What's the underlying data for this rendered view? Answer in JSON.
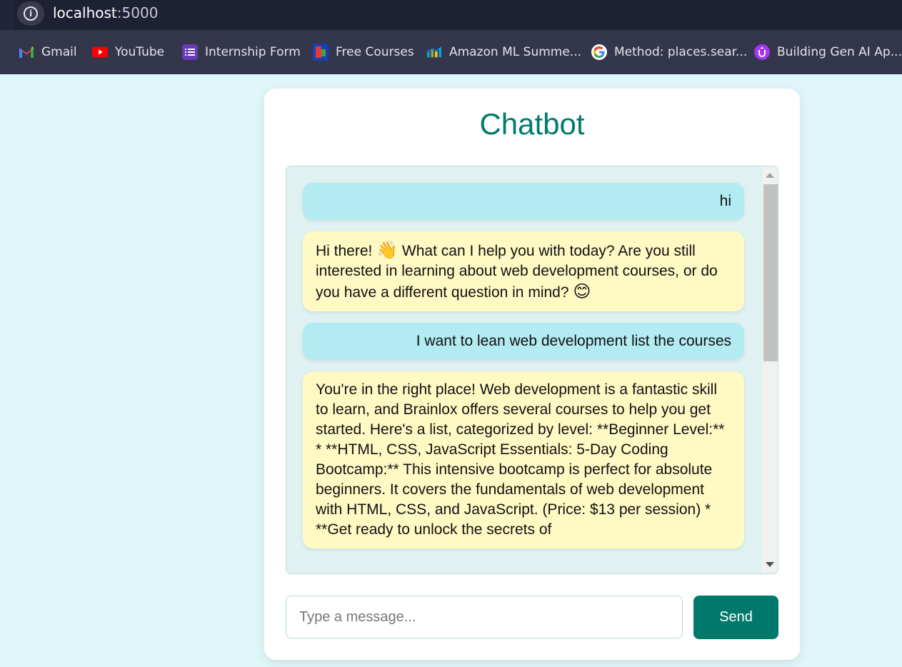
{
  "browser": {
    "url_host": "localhost",
    "url_port": ":5000",
    "bookmarks": [
      {
        "label": "Gmail",
        "icon": "gmail-icon"
      },
      {
        "label": "YouTube",
        "icon": "youtube-icon"
      },
      {
        "label": "Internship Form",
        "icon": "forms-icon"
      },
      {
        "label": "Free Courses",
        "icon": "courses-icon"
      },
      {
        "label": "Amazon ML Summe...",
        "icon": "chart-icon"
      },
      {
        "label": "Method: places.sear...",
        "icon": "google-icon"
      },
      {
        "label": "Building Gen AI Ap...",
        "icon": "udemy-icon"
      }
    ]
  },
  "chat": {
    "title": "Chatbot",
    "messages": [
      {
        "role": "user",
        "text": "hi"
      },
      {
        "role": "bot",
        "text": "Hi there! ",
        "emoji1": "👋",
        "text2": " What can I help you with today? Are you still interested in learning about web development courses, or do you have a different question in mind? ",
        "emoji2": "😊"
      },
      {
        "role": "user",
        "text": "I want to lean web development list the courses"
      },
      {
        "role": "bot",
        "text": "You're in the right place! Web development is a fantastic skill to learn, and Brainlox offers several courses to help you get started. Here's a list, categorized by level: **Beginner Level:** * **HTML, CSS, JavaScript Essentials: 5-Day Coding Bootcamp:** This intensive bootcamp is perfect for absolute beginners. It covers the fundamentals of web development with HTML, CSS, and JavaScript. (Price: $13 per session) * **Get ready to unlock the secrets of"
      }
    ],
    "input_placeholder": "Type a message...",
    "send_label": "Send"
  },
  "colors": {
    "page_bg": "#e0f7f9",
    "accent": "#00796b",
    "user_bubble": "#b2ebf2",
    "bot_bubble": "#fff9c4"
  }
}
